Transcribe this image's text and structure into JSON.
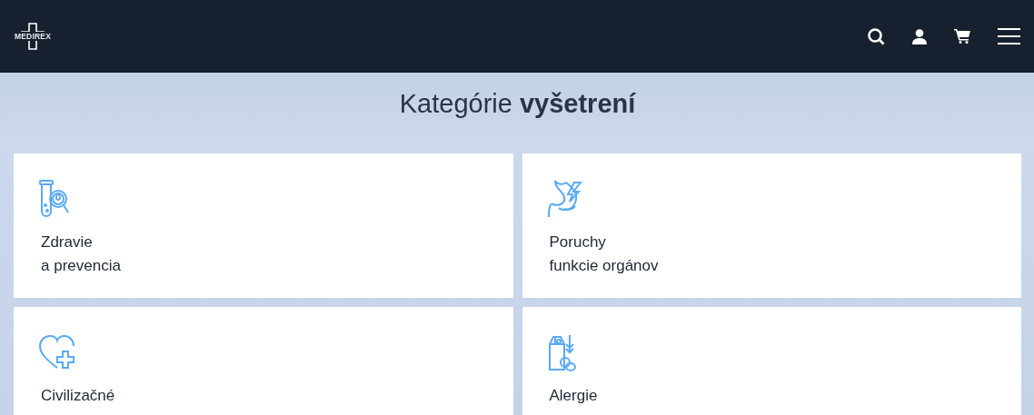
{
  "header": {
    "logo": "MEDIREX"
  },
  "title": "Kategórie **vyšetrení**",
  "cards": [
    {
      "kind": "tube",
      "label": "Zdravie\na prevencia"
    },
    {
      "kind": "stomach",
      "label": "Poruchy\nfunkcie orgánov"
    },
    {
      "kind": "heart",
      "label": "Civilizačné"
    },
    {
      "kind": "food",
      "label": "Alergie"
    }
  ]
}
